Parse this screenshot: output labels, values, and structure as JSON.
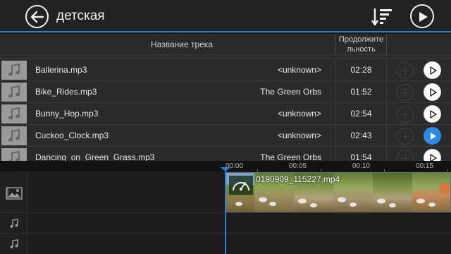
{
  "header": {
    "title": "детская",
    "back_icon": "back-arrow-icon",
    "sort_icon": "sort-icon",
    "play_icon": "play-icon"
  },
  "columns": {
    "name": "Название трека",
    "duration_line1": "Продолжите",
    "duration_line2": "льность"
  },
  "tracks": [
    {
      "name": "Ballerina.mp3",
      "artist": "<unknown>",
      "duration": "02:28",
      "active": false
    },
    {
      "name": "Bike_Rides.mp3",
      "artist": "The Green Orbs",
      "duration": "01:52",
      "active": false
    },
    {
      "name": "Bunny_Hop.mp3",
      "artist": "<unknown>",
      "duration": "02:54",
      "active": false
    },
    {
      "name": "Cuckoo_Clock.mp3",
      "artist": "<unknown>",
      "duration": "02:43",
      "active": true
    },
    {
      "name": "Dancing_on_Green_Grass.mp3",
      "artist": "The Green Orbs",
      "duration": "01:54",
      "active": false
    }
  ],
  "timeline": {
    "ticks": [
      "00:00",
      "00:05",
      "00:10",
      "00:15"
    ],
    "clip_label": "0190909_115227.mp4"
  },
  "colors": {
    "accent": "#2d7fcf",
    "active_play": "#2b8ae6"
  }
}
